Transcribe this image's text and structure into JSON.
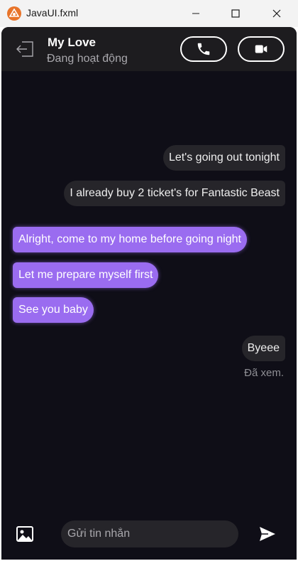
{
  "window": {
    "title": "JavaUI.fxml"
  },
  "header": {
    "contact_name": "My Love",
    "status": "Đang hoạt động"
  },
  "messages": [
    {
      "side": "sent",
      "text": "Let's going out tonight"
    },
    {
      "side": "sent",
      "text": "I already buy 2 ticket's for Fantastic Beast"
    },
    {
      "side": "recv",
      "text": "Alright, come to my home before going night"
    },
    {
      "side": "recv",
      "text": "Let me prepare myself first"
    },
    {
      "side": "recv",
      "text": "See you baby"
    },
    {
      "side": "sent",
      "text": "Byeee"
    }
  ],
  "seen_label": "Đã xem.",
  "composer": {
    "placeholder": "Gửi tin nhắn"
  },
  "colors": {
    "background": "#0f0e17",
    "header": "#1d1c1f",
    "sent_bubble": "#26252a",
    "received_bubble": "#9a6cf0"
  },
  "icons": [
    "app-logo-icon",
    "minimize-icon",
    "maximize-icon",
    "close-icon",
    "back-icon",
    "phone-icon",
    "video-camera-icon",
    "image-icon",
    "send-icon"
  ]
}
